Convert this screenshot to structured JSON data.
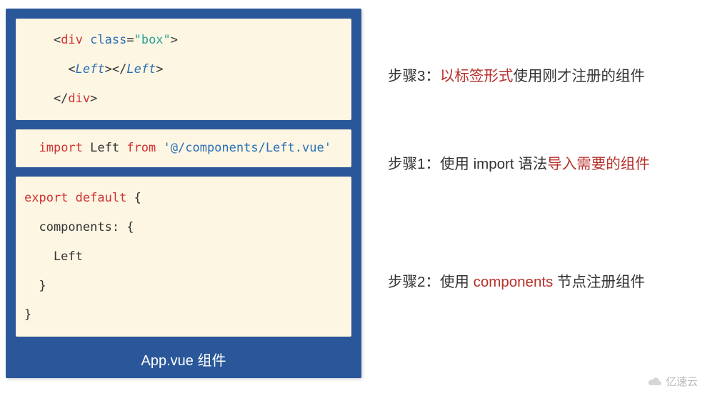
{
  "code": {
    "block1": {
      "l1": {
        "p1": "    <",
        "tag1": "div",
        "p2": " ",
        "attr": "class",
        "p3": "=",
        "val": "\"box\"",
        "p4": ">"
      },
      "l2": {
        "p1": "      <",
        "tag1": "Left",
        "p2": "></",
        "tag2": "Left",
        "p3": ">"
      },
      "l3": {
        "p1": "    </",
        "tag1": "div",
        "p2": ">"
      }
    },
    "block2": {
      "l1": {
        "p1": "  ",
        "kw1": "import",
        "p2": " Left ",
        "kw2": "from",
        "p3": " ",
        "str": "'@/components/Left.vue'"
      }
    },
    "block3": {
      "l1": {
        "kw1": "export",
        "p1": " ",
        "kw2": "default",
        "p2": " {"
      },
      "l2": "  components: {",
      "l3": "    Left",
      "l4": "  }",
      "l5": "}"
    }
  },
  "caption": "App.vue 组件",
  "steps": {
    "s3": {
      "pre": "步骤3：",
      "red": "以标签形式",
      "post": "使用刚才注册的组件"
    },
    "s1": {
      "pre": "步骤1：使用 import 语法",
      "red": "导入需要的组件",
      "post": ""
    },
    "s2": {
      "pre": "步骤2：使用 ",
      "red": "components",
      "post": " 节点注册组件"
    }
  },
  "watermark": "亿速云"
}
